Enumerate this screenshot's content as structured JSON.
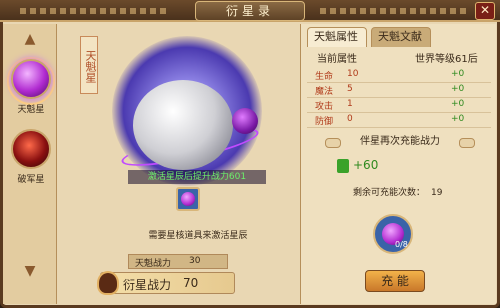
{
  "window": {
    "title": "衍星录",
    "close_icon": "close-icon"
  },
  "sidebar": {
    "items": [
      {
        "label": "天魁星",
        "icon": "purple-star-orb"
      },
      {
        "label": "破军星",
        "icon": "red-star-orb"
      }
    ]
  },
  "center": {
    "vertical_tag": "天魁星",
    "activate_tip": "激活星辰后提升战力601",
    "need_text": "需要星核道具来激活星辰",
    "star_power": {
      "label": "天魁战力",
      "value": "30"
    },
    "total_power": {
      "label": "衍星战力",
      "value": "70"
    }
  },
  "right": {
    "tabs": [
      {
        "label": "天魁属性",
        "active": true
      },
      {
        "label": "天魁文献",
        "active": false
      }
    ],
    "attributes": {
      "header_current": "当前属性",
      "header_world": "世界等级61后",
      "rows": [
        {
          "name": "生命",
          "value": "10",
          "bonus": "+0"
        },
        {
          "name": "魔法",
          "value": "5",
          "bonus": "+0"
        },
        {
          "name": "攻击",
          "value": "1",
          "bonus": "+0"
        },
        {
          "name": "防御",
          "value": "0",
          "bonus": "+0"
        }
      ]
    },
    "section_title": "伴星再次充能战力",
    "add_power": "+60",
    "remain_label": "剩余可充能次数：",
    "remain_value": "19",
    "charge_count": "0/8",
    "charge_button": "充 能"
  }
}
